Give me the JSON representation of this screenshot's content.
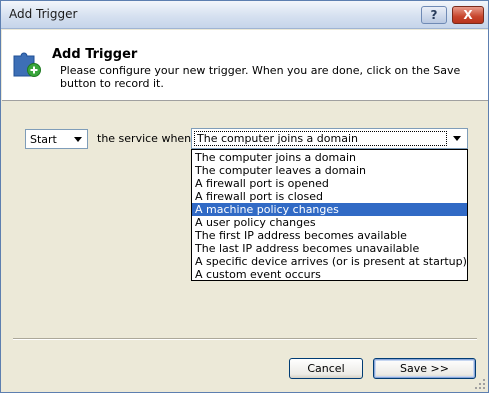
{
  "window": {
    "title": "Add Trigger",
    "help_label": "?",
    "close_label": "X"
  },
  "header": {
    "title": "Add Trigger",
    "description": "Please configure your new trigger. When you are done, click on the Save button to record it."
  },
  "form": {
    "action_value": "Start",
    "service_label": "the service when:",
    "event_value": "The computer joins a domain",
    "event_options": [
      "The computer joins a domain",
      "The computer leaves a domain",
      "A firewall port is opened",
      "A firewall port is closed",
      "A machine policy changes",
      "A user policy changes",
      "The first IP address becomes available",
      "The last IP address becomes unavailable",
      "A specific device arrives (or is present at startup)",
      "A custom event occurs"
    ],
    "highlighted_option": "A machine policy changes"
  },
  "buttons": {
    "cancel_label": "Cancel",
    "save_label": "Save >>"
  },
  "colors": {
    "highlight": "#316ac5",
    "dialog_bg": "#ece9d8"
  }
}
